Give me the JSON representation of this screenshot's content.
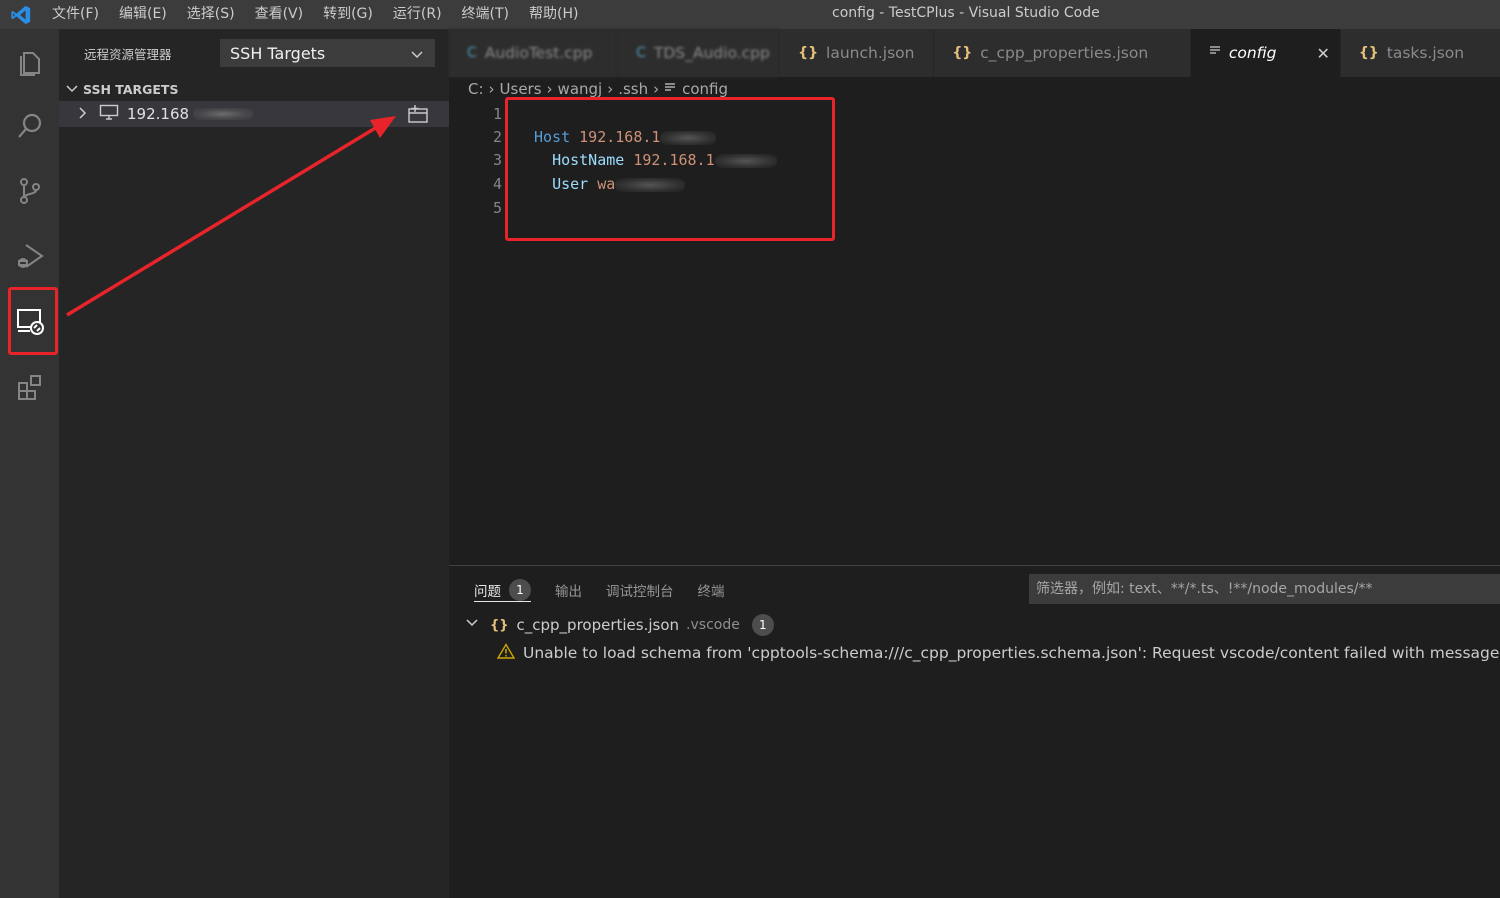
{
  "titlebar": {
    "title": "config - TestCPlus - Visual Studio Code",
    "menu": [
      "文件(F)",
      "编辑(E)",
      "选择(S)",
      "查看(V)",
      "转到(G)",
      "运行(R)",
      "终端(T)",
      "帮助(H)"
    ]
  },
  "activitybar": {
    "items": [
      "files-icon",
      "search-icon",
      "source-control-icon",
      "run-debug-icon",
      "remote-explorer-icon",
      "extensions-icon"
    ]
  },
  "sidebar": {
    "title": "远程资源管理器",
    "target_select": "SSH Targets",
    "section": "SSH TARGETS",
    "host": "192.168"
  },
  "tabs": [
    {
      "label": "AudioTest.cpp"
    },
    {
      "label": "TDS_Audio.cpp"
    },
    {
      "label": "launch.json"
    },
    {
      "label": "c_cpp_properties.json"
    },
    {
      "label": "config"
    },
    {
      "label": "tasks.json"
    }
  ],
  "breadcrumb": [
    "C:",
    "Users",
    "wangj",
    ".ssh",
    "config"
  ],
  "editor": {
    "line_numbers": [
      "1",
      "2",
      "3",
      "4",
      "5"
    ],
    "host_kw": "Host",
    "host_val": "192.168.1",
    "hostname_kw": "HostName",
    "hostname_val": "192.168.1",
    "user_kw": "User",
    "user_val": "wa"
  },
  "panel": {
    "tabs": [
      "问题",
      "输出",
      "调试控制台",
      "终端"
    ],
    "problem_count": "1",
    "filter_placeholder": "筛选器，例如: text、**/*.ts、!**/node_modules/**",
    "problem_file": "c_cpp_properties.json",
    "problem_dir": ".vscode",
    "problem_file_count": "1",
    "problem_message": "Unable to load schema from 'cpptools-schema:///c_cpp_properties.schema.json': Request vscode/content failed with message: cannot op"
  },
  "colors": {
    "highlight": "#e8242a",
    "accent": "#0078d4"
  }
}
